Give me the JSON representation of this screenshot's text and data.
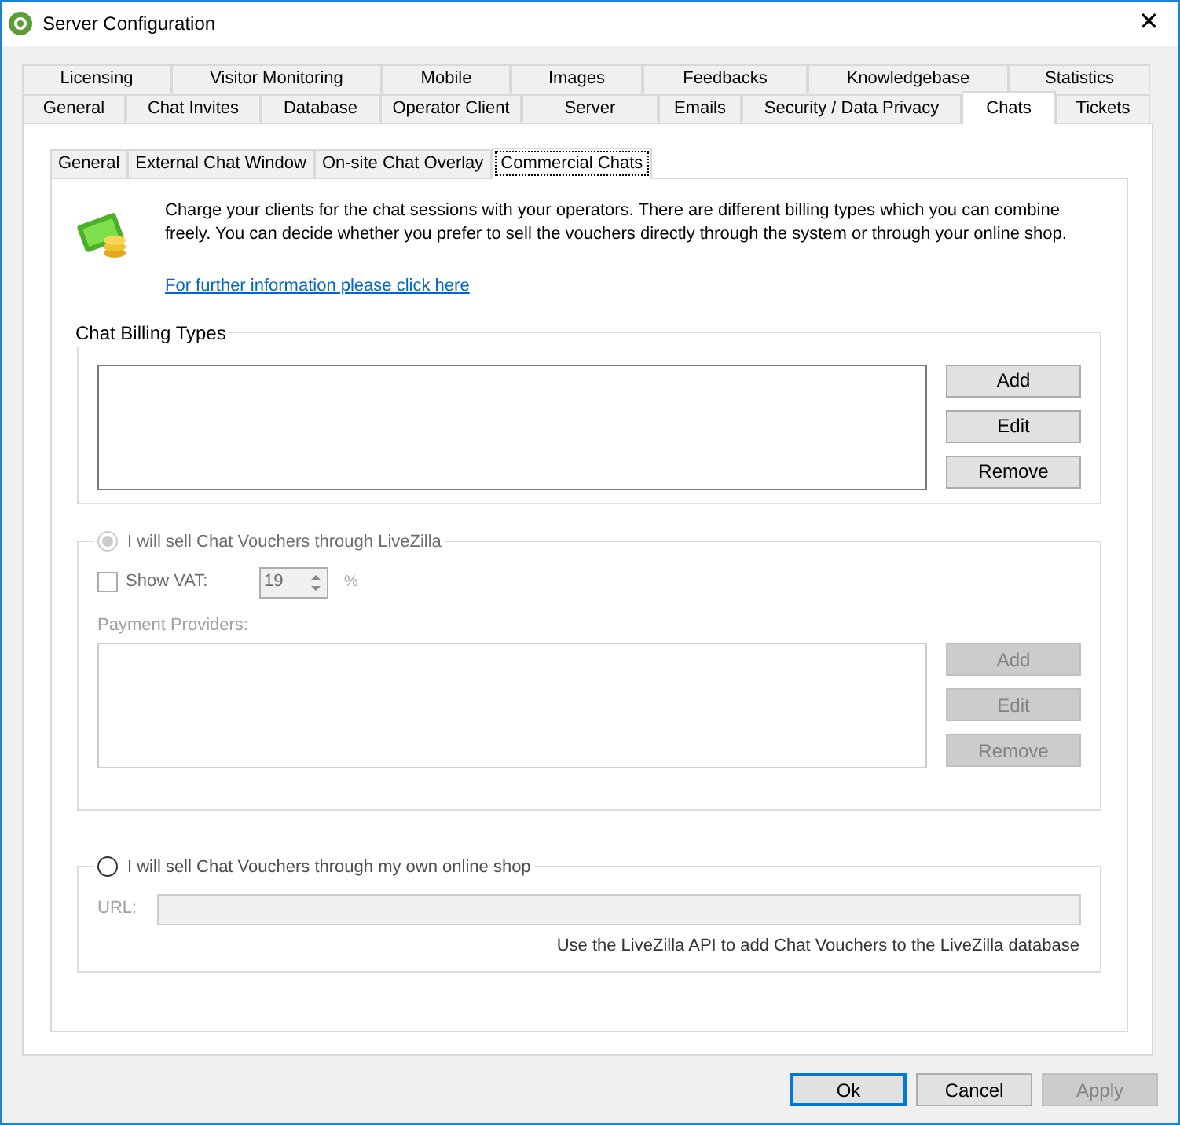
{
  "window": {
    "title": "Server Configuration",
    "close": "✕"
  },
  "tab_rows": [
    [
      {
        "label": "Licensing",
        "selected": false
      },
      {
        "label": "Visitor Monitoring",
        "selected": false
      },
      {
        "label": "Mobile",
        "selected": false
      },
      {
        "label": "Images",
        "selected": false
      },
      {
        "label": "Feedbacks",
        "selected": false
      },
      {
        "label": "Knowledgebase",
        "selected": false
      },
      {
        "label": "Statistics",
        "selected": false
      }
    ],
    [
      {
        "label": "General",
        "selected": false
      },
      {
        "label": "Chat Invites",
        "selected": false
      },
      {
        "label": "Database",
        "selected": false
      },
      {
        "label": "Operator Client",
        "selected": false
      },
      {
        "label": "Server",
        "selected": false
      },
      {
        "label": "Emails",
        "selected": false
      },
      {
        "label": "Security / Data Privacy",
        "selected": false
      },
      {
        "label": "Chats",
        "selected": true
      },
      {
        "label": "Tickets",
        "selected": false
      }
    ]
  ],
  "sub_tabs": [
    {
      "label": "General",
      "selected": false
    },
    {
      "label": "External Chat Window",
      "selected": false
    },
    {
      "label": "On-site Chat Overlay",
      "selected": false
    },
    {
      "label": "Commercial Chats",
      "selected": true
    }
  ],
  "intro": {
    "text": "Charge your clients for the chat sessions with your operators. There are different billing types which you can combine freely. You can decide whether you prefer to sell the vouchers directly through the system or through your online shop.",
    "link": "For further information please click here"
  },
  "billing": {
    "title": "Chat Billing Types",
    "buttons": [
      {
        "label": "Add",
        "disabled": false
      },
      {
        "label": "Edit",
        "disabled": false
      },
      {
        "label": "Remove",
        "disabled": false
      }
    ]
  },
  "livezilla": {
    "label": "I will sell Chat Vouchers through LiveZilla",
    "selected": true,
    "disabled": true,
    "vat": {
      "label": "Show VAT:",
      "checked": false,
      "value": "19",
      "unit": "%"
    },
    "providers_label": "Payment Providers:",
    "buttons": [
      {
        "label": "Add",
        "disabled": true
      },
      {
        "label": "Edit",
        "disabled": true
      },
      {
        "label": "Remove",
        "disabled": true
      }
    ]
  },
  "shop": {
    "label": "I will sell Chat Vouchers through my own online shop",
    "selected": false,
    "url_label": "URL:",
    "note": "Use the LiveZilla API to add Chat Vouchers to the LiveZilla database"
  },
  "footer": [
    {
      "label": "Ok",
      "default": true,
      "disabled": false
    },
    {
      "label": "Cancel",
      "default": false,
      "disabled": false
    },
    {
      "label": "Apply",
      "default": false,
      "disabled": true
    }
  ]
}
